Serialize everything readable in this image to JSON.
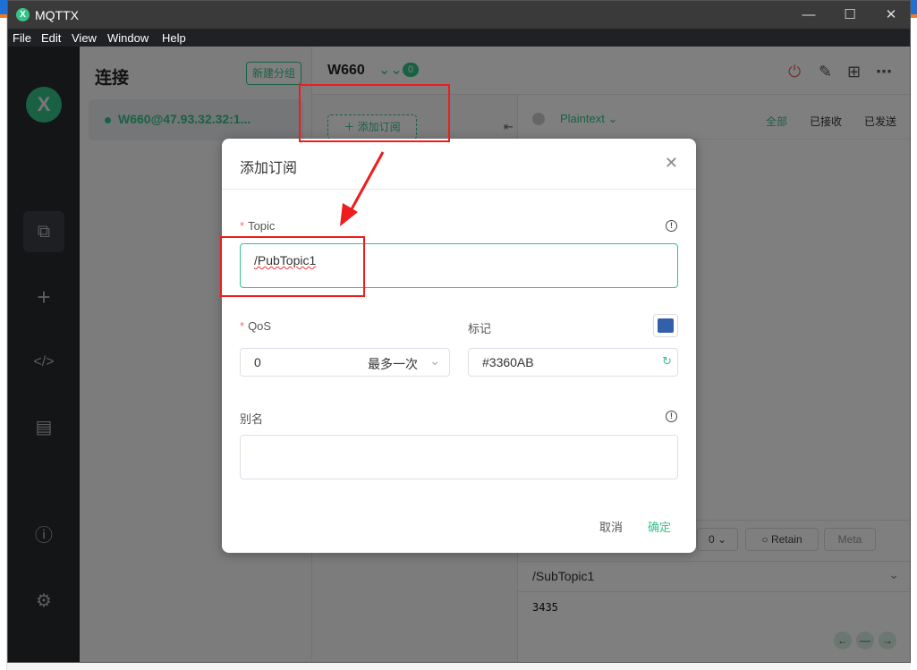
{
  "window": {
    "title": "MQTTX",
    "logo": "X",
    "controls": [
      "minimize",
      "maximize",
      "close"
    ]
  },
  "menu": [
    "File",
    "Edit",
    "View",
    "Window",
    "Help"
  ],
  "sidebar": {
    "brand": "X",
    "items": [
      "connections",
      "new",
      "scripts",
      "log",
      "about",
      "settings"
    ]
  },
  "connections": {
    "title": "连接",
    "new_group": "新建分组",
    "items": [
      {
        "label": "W660@47.93.32.32:1...",
        "status": "connected"
      }
    ]
  },
  "header": {
    "name": "W660",
    "sub_count": "0"
  },
  "subscriptions": {
    "add_label": "添加订阅"
  },
  "messages": {
    "format": "Plaintext",
    "filters": [
      "全部",
      "已接收",
      "已发送"
    ]
  },
  "publish": {
    "qos": "0",
    "retain": "Retain",
    "meta": "Meta",
    "topic": "/SubTopic1",
    "payload": "3435"
  },
  "dialog": {
    "title": "添加订阅",
    "topic_label": "Topic",
    "topic_value": "/PubTopic1",
    "qos_label": "QoS",
    "qos_value": "0",
    "qos_desc": "最多一次",
    "mark_label": "标记",
    "color_value": "#3360AB",
    "color": "#3360AB",
    "alias_label": "别名",
    "alias_value": "",
    "cancel": "取消",
    "confirm": "确定"
  },
  "colors": {
    "accent": "#34c388",
    "annotation": "#f01c1c"
  }
}
